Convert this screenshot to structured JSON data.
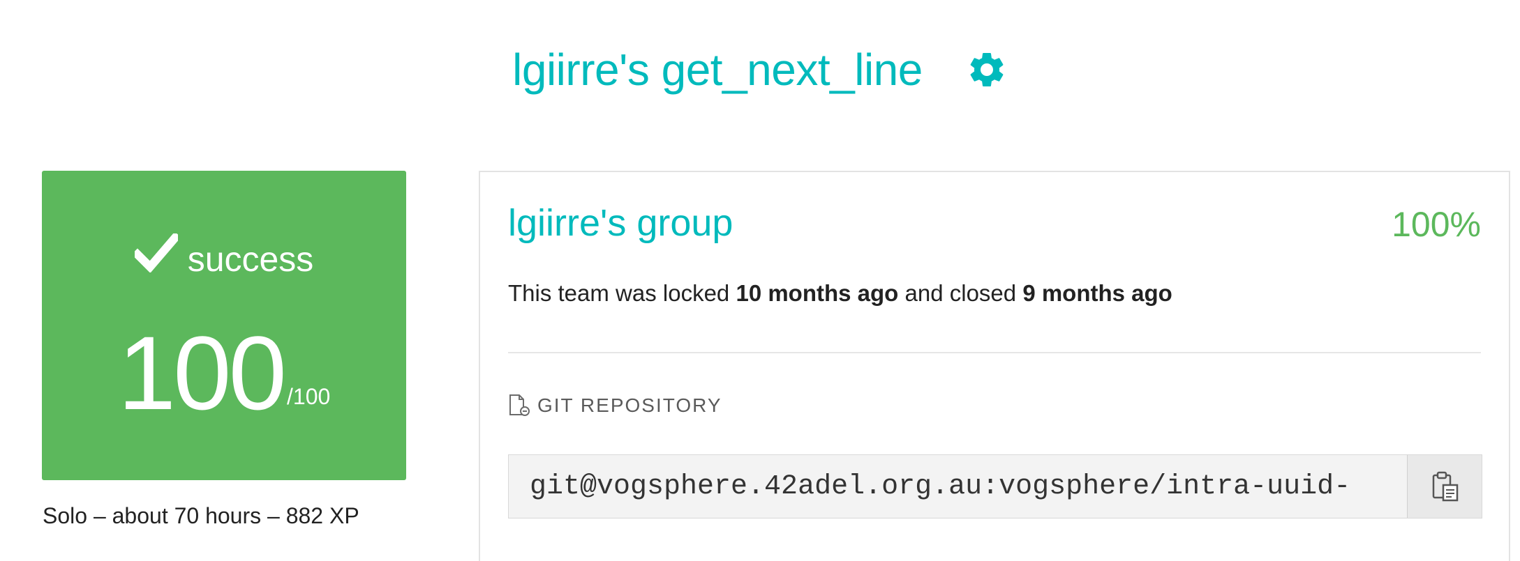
{
  "header": {
    "title": "lgiirre's get_next_line",
    "settings_icon": "gear-icon",
    "accent_color": "#00babc"
  },
  "status": {
    "icon": "check-icon",
    "label": "success",
    "score": "100",
    "max": "/100",
    "color": "#5cb85c"
  },
  "project_meta": "Solo – about 70 hours – 882 XP",
  "team": {
    "name": "lgiirre's group",
    "percent": "100%",
    "lock_prefix": "This team was locked ",
    "locked_when": "10 months ago",
    "lock_middle": " and closed ",
    "closed_when": "9 months ago"
  },
  "repository": {
    "icon": "git-repo-icon",
    "label": "GIT REPOSITORY",
    "url": "git@vogsphere.42adel.org.au:vogsphere/intra-uuid-",
    "copy_icon": "clipboard-icon"
  }
}
